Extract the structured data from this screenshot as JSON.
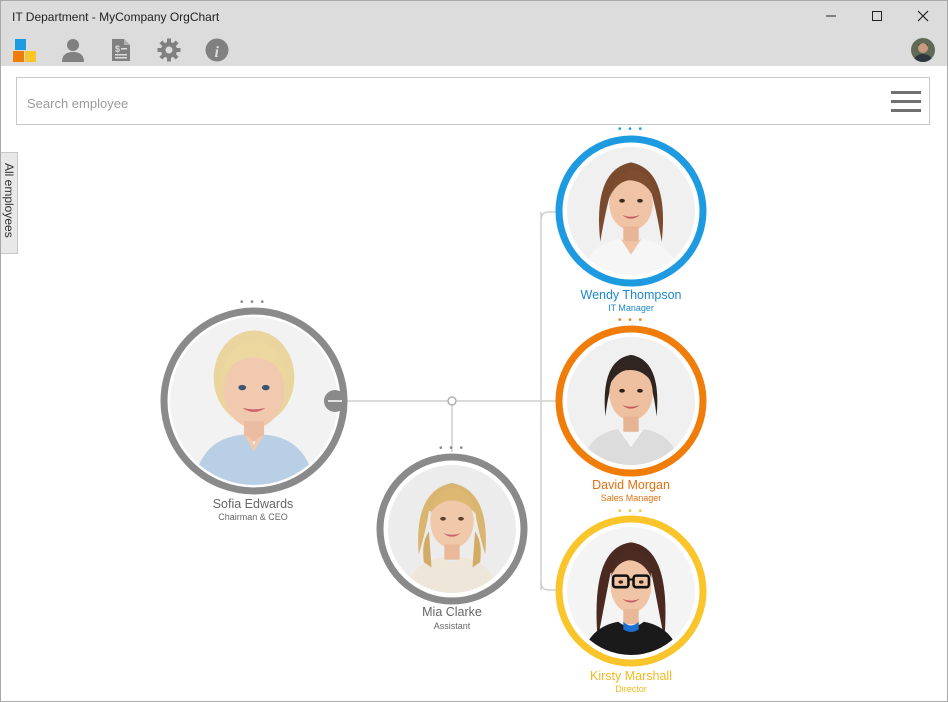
{
  "window": {
    "title": "IT Department - MyCompany OrgChart",
    "controls": [
      "minimize",
      "maximize",
      "close"
    ]
  },
  "toolbar": {
    "icons": [
      "app-logo-icon",
      "person-icon",
      "document-dollar-icon",
      "gear-icon",
      "info-icon",
      "user-avatar"
    ]
  },
  "search": {
    "placeholder": "Search employee"
  },
  "side_tab": {
    "label": "All employees"
  },
  "employees": [
    {
      "name": "Sofia Edwards",
      "title": "Chairman & CEO",
      "ring_color": "#8a8a8a",
      "name_color": "#666666",
      "title_color": "#666666"
    },
    {
      "name": "Mia Clarke",
      "title": "Assistant",
      "ring_color": "#8a8a8a",
      "name_color": "#666666",
      "title_color": "#666666"
    },
    {
      "name": "Wendy Thompson",
      "title": "IT Manager",
      "ring_color": "#1e9be0",
      "name_color": "#1e88c8",
      "title_color": "#1e88c8"
    },
    {
      "name": "David Morgan",
      "title": "Sales Manager",
      "ring_color": "#f07d0a",
      "name_color": "#e07010",
      "title_color": "#e07010"
    },
    {
      "name": "Kirsty Marshall",
      "title": "Director",
      "ring_color": "#f9c52a",
      "name_color": "#f0b820",
      "title_color": "#f0b820"
    }
  ],
  "more_indicator": "• • •"
}
